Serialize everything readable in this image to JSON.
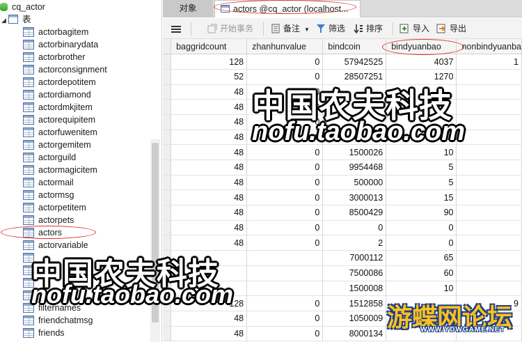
{
  "tree": {
    "database": "cq_actor",
    "folder": "表",
    "tables": [
      "actorbagitem",
      "actorbinarydata",
      "actorbrother",
      "actorconsignment",
      "actordepotitem",
      "actordiamond",
      "actordmkjitem",
      "actorequipitem",
      "actorfuwenitem",
      "actorgemitem",
      "actorguild",
      "actormagicitem",
      "actormail",
      "actormsg",
      "actorpetitem",
      "actorpets",
      "actors",
      "actorvariable",
      "",
      "",
      "",
      "",
      "filternames",
      "friendchatmsg",
      "friends"
    ],
    "selected": "actors"
  },
  "tabs": {
    "objects": "对象",
    "active": "actors @cq_actor (localhost..."
  },
  "toolbar": {
    "menu_icon": "hamburger-icon",
    "begin_transaction": "开始事务",
    "memo": "备注",
    "filter": "筛选",
    "sort": "排序",
    "import": "导入",
    "export": "导出"
  },
  "grid": {
    "columns": [
      "baggridcount",
      "zhanhunvalue",
      "bindcoin",
      "bindyuanbao",
      "nonbindyuanba"
    ],
    "rows": [
      [
        "128",
        "0",
        "57942525",
        "4037",
        "1"
      ],
      [
        "52",
        "0",
        "28507251",
        "1270",
        ""
      ],
      [
        "48",
        "0",
        "",
        "",
        ""
      ],
      [
        "48",
        "0",
        "",
        "",
        ""
      ],
      [
        "48",
        "0",
        "",
        "",
        ""
      ],
      [
        "48",
        "0",
        "",
        "",
        ""
      ],
      [
        "48",
        "0",
        "1500026",
        "10",
        ""
      ],
      [
        "48",
        "0",
        "9954468",
        "5",
        ""
      ],
      [
        "48",
        "0",
        "500000",
        "5",
        ""
      ],
      [
        "48",
        "0",
        "3000013",
        "15",
        ""
      ],
      [
        "48",
        "0",
        "8500429",
        "90",
        ""
      ],
      [
        "48",
        "0",
        "0",
        "0",
        ""
      ],
      [
        "48",
        "0",
        "2",
        "0",
        ""
      ],
      [
        "",
        "",
        "7000112",
        "65",
        ""
      ],
      [
        "",
        "",
        "7500086",
        "60",
        ""
      ],
      [
        "",
        "",
        "1500008",
        "10",
        ""
      ],
      [
        "128",
        "0",
        "1512858",
        "",
        "9"
      ],
      [
        "48",
        "0",
        "1050009",
        "",
        ""
      ],
      [
        "48",
        "0",
        "8000134",
        "",
        ""
      ]
    ]
  },
  "watermarks": {
    "cn": "中国农夫科技",
    "url": "nofu.taobao.com",
    "forum": "游蝶网论坛",
    "forum_url": "WWW.YDWGAME.NET"
  }
}
